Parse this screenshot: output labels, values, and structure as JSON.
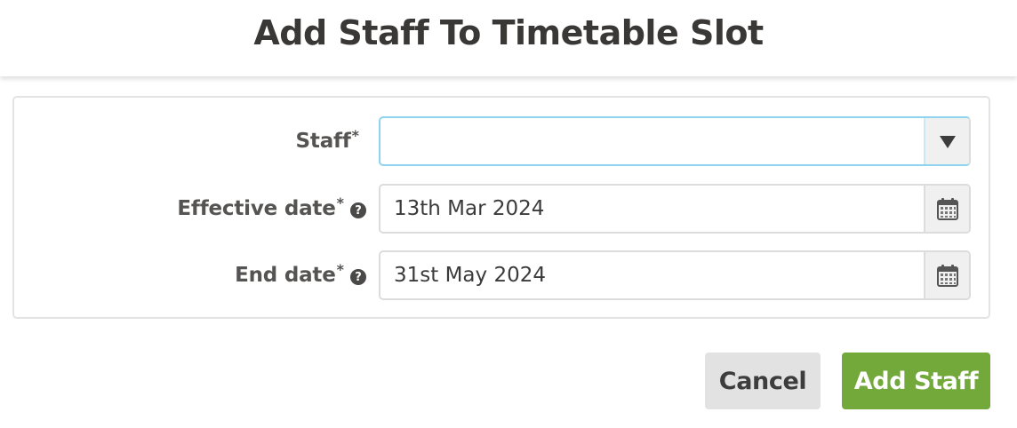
{
  "modal": {
    "title": "Add Staff To Timetable Slot"
  },
  "form": {
    "staff": {
      "label": "Staff",
      "required_marker": "*",
      "value": "",
      "placeholder": "",
      "dropdown_icon": "caret-down-icon"
    },
    "effective_date": {
      "label": "Effective date",
      "required_marker": "*",
      "help_icon": "question-circle-icon",
      "help_glyph": "?",
      "value": "13th Mar 2024",
      "picker_icon": "calendar-icon"
    },
    "end_date": {
      "label": "End date",
      "required_marker": "*",
      "help_icon": "question-circle-icon",
      "help_glyph": "?",
      "value": "31st May 2024",
      "picker_icon": "calendar-icon"
    }
  },
  "actions": {
    "cancel_label": "Cancel",
    "add_label": "Add Staff"
  },
  "colors": {
    "primary_button": "#73a83a",
    "secondary_button": "#e2e2e2",
    "focus_border": "#8fd4ee",
    "title_text": "#3a3836"
  }
}
